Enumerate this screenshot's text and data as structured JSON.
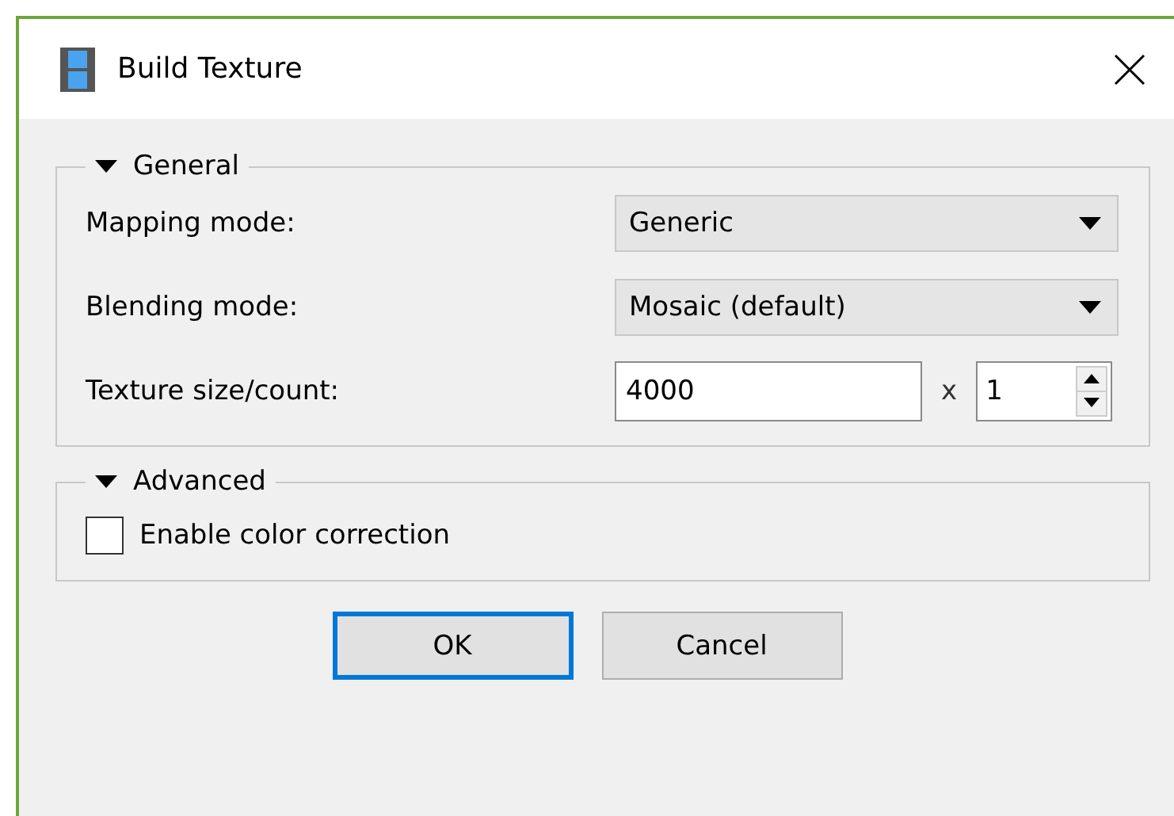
{
  "window": {
    "title": "Build Texture"
  },
  "sections": [
    {
      "title": "General",
      "expanded": true,
      "rows": [
        {
          "kind": "dropdown",
          "label": "Mapping mode:",
          "value": "Generic"
        },
        {
          "kind": "dropdown",
          "label": "Blending mode:",
          "value": "Mosaic (default)"
        },
        {
          "kind": "size",
          "label": "Texture size/count:",
          "value": "4000",
          "separator": "x",
          "count": "1"
        }
      ]
    },
    {
      "title": "Advanced",
      "expanded": true,
      "rows": [
        {
          "kind": "checkbox",
          "label": "Enable color correction",
          "checked": false
        }
      ]
    }
  ],
  "buttons": [
    {
      "label": "OK",
      "default": true
    },
    {
      "label": "Cancel",
      "default": false
    }
  ]
}
